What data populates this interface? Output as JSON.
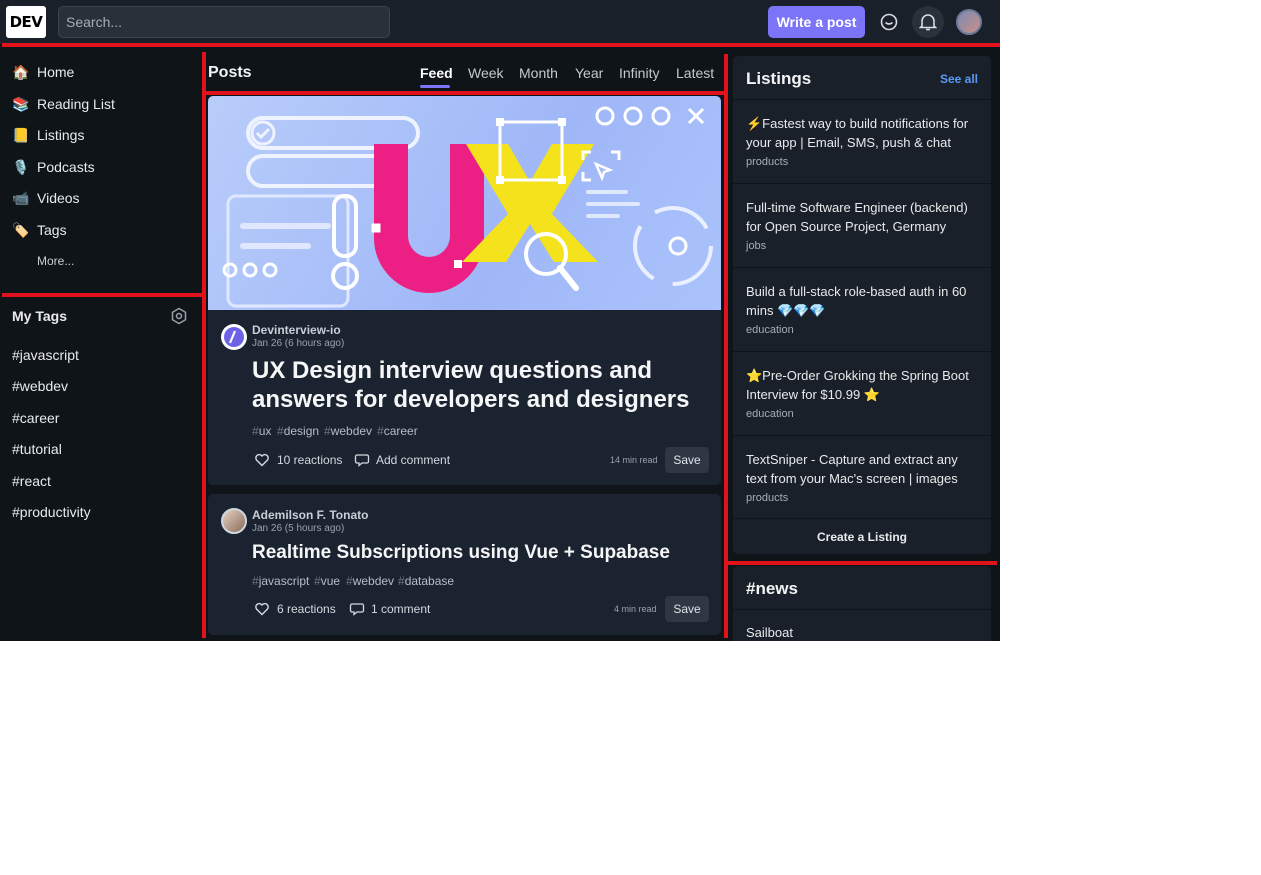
{
  "header": {
    "logo": "DEV",
    "search_placeholder": "Search...",
    "write_post_label": "Write a post"
  },
  "sidebar": {
    "nav": [
      {
        "icon": "🏠",
        "label": "Home"
      },
      {
        "icon": "📚",
        "label": "Reading List"
      },
      {
        "icon": "📒",
        "label": "Listings"
      },
      {
        "icon": "🎙️",
        "label": "Podcasts"
      },
      {
        "icon": "📹",
        "label": "Videos"
      },
      {
        "icon": "🏷️",
        "label": "Tags"
      }
    ],
    "more_label": "More...",
    "my_tags_title": "My Tags",
    "tags": [
      "#javascript",
      "#webdev",
      "#career",
      "#tutorial",
      "#react",
      "#productivity"
    ]
  },
  "feed": {
    "title": "Posts",
    "tabs": [
      "Feed",
      "Week",
      "Month",
      "Year",
      "Infinity",
      "Latest"
    ],
    "active_tab": "Feed",
    "posts": [
      {
        "cover_text": "UX",
        "author": "Devinterview-io",
        "date": "Jan 26 (6 hours ago)",
        "title_line1": "UX Design interview questions and",
        "title_line2": "answers for developers and designers",
        "tags": [
          "ux",
          "design",
          "webdev",
          "career"
        ],
        "reactions": "10 reactions",
        "comments": "Add comment",
        "read_time": "14 min read",
        "save_label": "Save"
      },
      {
        "author": "Ademilson F. Tonato",
        "date": "Jan 26 (5 hours ago)",
        "title_line1": "Realtime Subscriptions using Vue + Supabase",
        "tags": [
          "javascript",
          "vue",
          "webdev",
          "database"
        ],
        "reactions": "6 reactions",
        "comments": "1 comment",
        "read_time": "4 min read",
        "save_label": "Save"
      }
    ]
  },
  "listings": {
    "title": "Listings",
    "see_all": "See all",
    "items": [
      {
        "line1": "⚡Fastest way to build notifications for",
        "line2": "your app | Email, SMS, push & chat",
        "category": "products"
      },
      {
        "line1": "Full-time Software Engineer (backend)",
        "line2": "for Open Source Project, Germany",
        "category": "jobs"
      },
      {
        "line1": "Build a full-stack role-based auth in 60",
        "line2": "mins 💎💎💎",
        "category": "education"
      },
      {
        "line1": "⭐Pre-Order Grokking the Spring Boot",
        "line2": "Interview for $10.99 ⭐",
        "category": "education"
      },
      {
        "line1": "TextSniper - Capture and extract any",
        "line2": "text from your Mac's screen | images",
        "category": "products"
      }
    ],
    "create_label": "Create a Listing"
  },
  "news": {
    "title": "#news",
    "first_item": "Sailboat"
  },
  "colors": {
    "accent": "#7b74f7",
    "highlight_border": "#e1121b",
    "link": "#5a9af5",
    "background": "#0f1419"
  }
}
